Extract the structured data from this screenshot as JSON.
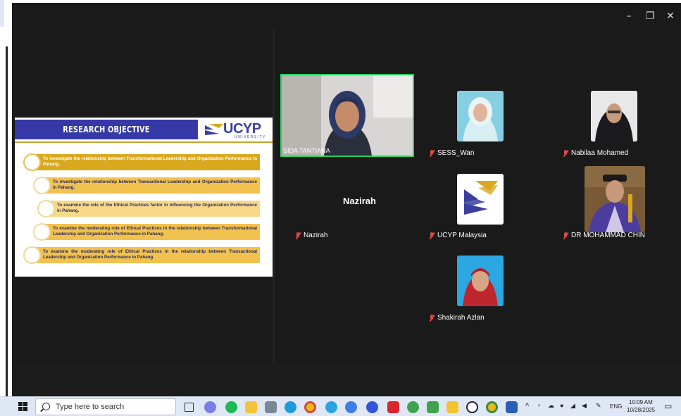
{
  "window": {
    "minimize_glyph": "–",
    "restore_glyph": "❐",
    "close_glyph": "✕"
  },
  "slide": {
    "title": "RESEARCH OBJECTIVE",
    "logo_text": "UCYP",
    "logo_subtext": "UNIVERSITY",
    "objectives": [
      "To investigate the relationship between Transformational Leadership and Organization Performance in Pahang.",
      "To investigate the relationship between Transactional Leadership and Organization Performance in Pahang.",
      "To examine the role of the Ethical Practices factor in influencing the Organization Performance in Pahang.",
      "To examine the moderating role of Ethical Practices in the relationship between Transformational Leadership and Organization Performance in Pahang.",
      "To examine the moderating role of Ethical Practices in the relationship between Transactional Leadership and Organization Performance in Pahang."
    ],
    "colors": {
      "header": "#3538a6",
      "bar_dark": "#d9a81e",
      "bar_mid": "#f2c24e",
      "bar_light": "#f8d98a"
    }
  },
  "participants": {
    "active_speaker": "SIDA TANTIANA",
    "tiles": [
      {
        "name": "SESS_Wan",
        "muted": true
      },
      {
        "name": "Nabilaa Mohamed",
        "muted": true
      },
      {
        "name": "Nazirah",
        "muted": true,
        "display_name": "Nazirah"
      },
      {
        "name": "UCYP Malaysia",
        "muted": true
      },
      {
        "name": "DR MOHAMMAD CHIN",
        "muted": true
      },
      {
        "name": "Shakirah Azlan",
        "muted": true
      }
    ]
  },
  "taskbar": {
    "search_placeholder": "Type here to search",
    "language": "ENG",
    "time": "10:09 AM",
    "date": "10/28/2025",
    "apps": [
      "task-view",
      "copilot",
      "spotify",
      "file-explorer",
      "photos",
      "edge",
      "chrome",
      "telegram",
      "zoom-meetings",
      "zoom",
      "acrobat",
      "teams-green",
      "excel-like",
      "sticky-notes",
      "whatsapp",
      "chrome-alt",
      "word"
    ]
  }
}
